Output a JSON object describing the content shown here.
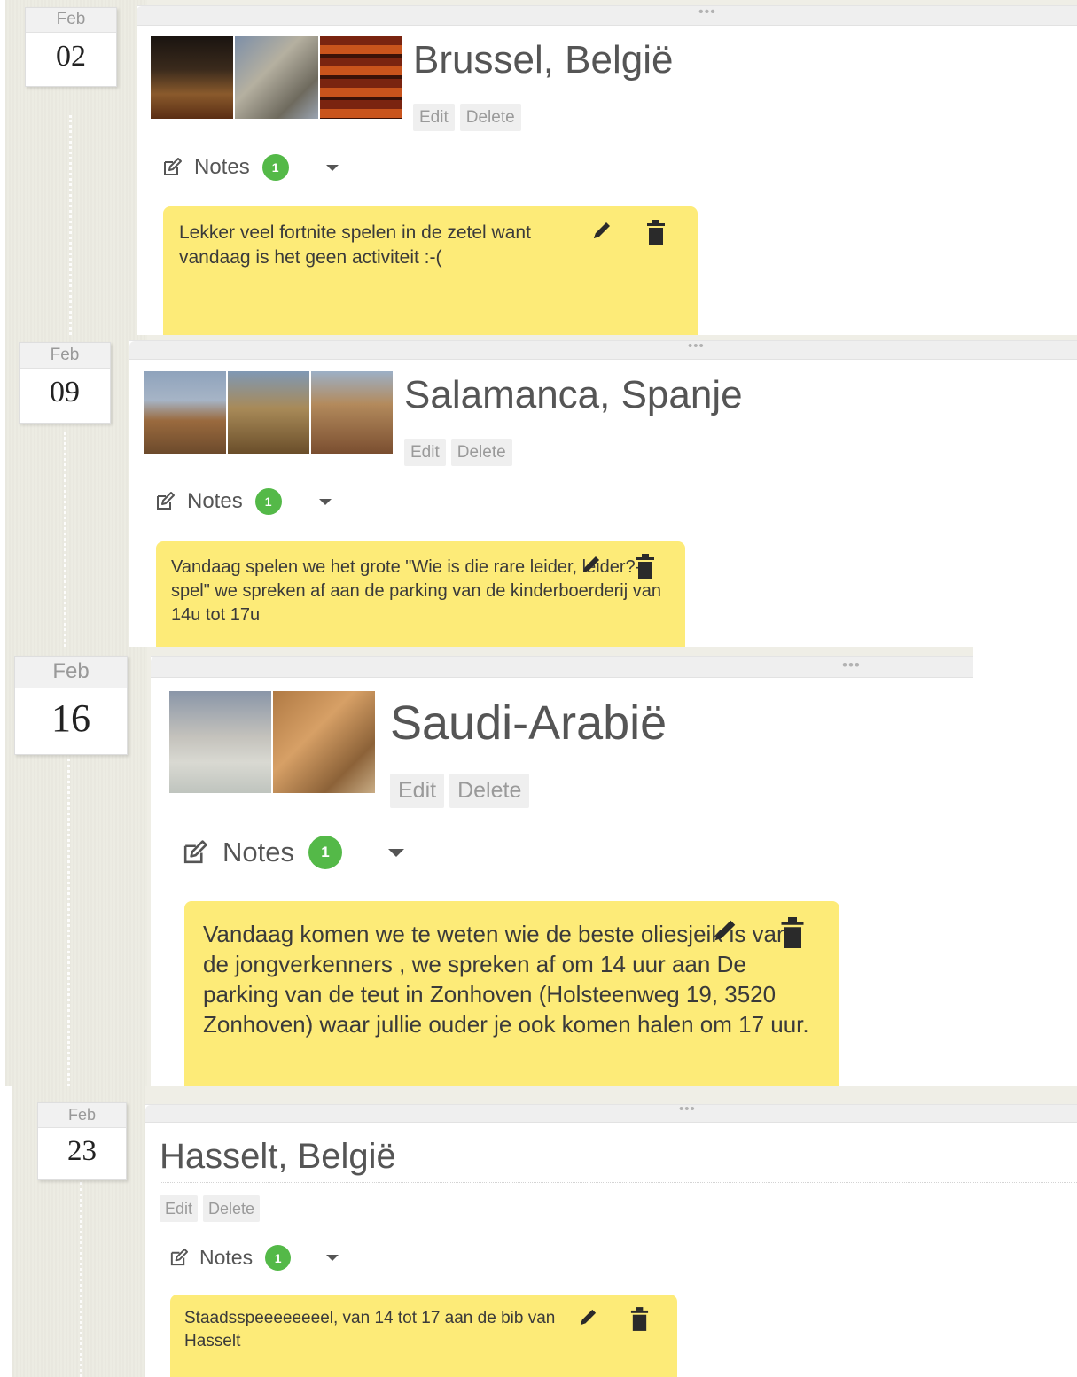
{
  "entries": [
    {
      "month": "Feb",
      "day": "02",
      "title": "Brussel, België",
      "edit_label": "Edit",
      "delete_label": "Delete",
      "notes_label": "Notes",
      "notes_count": "1",
      "note_text": "Lekker veel fortnite spelen in de zetel want vandaag is het geen activiteit :-(",
      "photos": [
        "brussels-grand-place-photo",
        "brussels-comic-mural-photo",
        "brussels-beer-shelves-photo"
      ]
    },
    {
      "month": "Feb",
      "day": "09",
      "title": "Salamanca, Spanje",
      "edit_label": "Edit",
      "delete_label": "Delete",
      "notes_label": "Notes",
      "notes_count": "1",
      "note_text": "Vandaag spelen we het grote \"Wie is die rare leider, leider?-spel\" we spreken af aan de parking van de kinderboerderij van 14u tot 17u",
      "photos": [
        "salamanca-cathedral-photo",
        "salamanca-dome-photo",
        "salamanca-rooftops-photo"
      ]
    },
    {
      "month": "Feb",
      "day": "16",
      "title": "Saudi-Arabië",
      "edit_label": "Edit",
      "delete_label": "Delete",
      "notes_label": "Notes",
      "notes_count": "1",
      "note_text": "Vandaag komen we te weten wie de beste oliesjeik is van de jongverkenners , we spreken af om 14 uur aan De parking van de teut in Zonhoven (Holsteenweg 19, 3520 Zonhoven) waar jullie ouder je ook komen halen om 17 uur.",
      "photos": [
        "mecca-kaaba-photo",
        "camel-man-photo"
      ]
    },
    {
      "month": "Feb",
      "day": "23",
      "title": "Hasselt, België",
      "edit_label": "Edit",
      "delete_label": "Delete",
      "notes_label": "Notes",
      "notes_count": "1",
      "note_text": "Staadsspeeeeeeeel, van 14 tot 17 aan de bib van Hasselt",
      "photos": []
    }
  ],
  "colors": {
    "note_background": "#fdeb78",
    "badge_green": "#54b948",
    "timeline_background": "#efeee6"
  },
  "icons": {
    "notes": "pencil-square-icon",
    "expand": "caret-down-icon",
    "edit_note": "pencil-icon",
    "delete_note": "trash-icon",
    "card_menu": "ellipsis-icon"
  }
}
